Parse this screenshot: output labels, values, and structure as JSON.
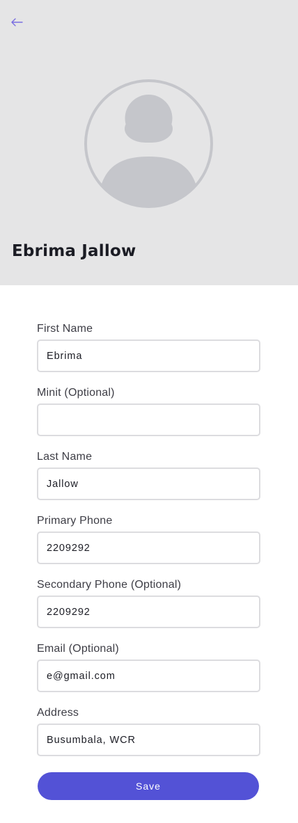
{
  "profile": {
    "name": "Ebrima Jallow"
  },
  "colors": {
    "header_bg": "#e5e5e6",
    "avatar": "#c5c6cb",
    "accent": "#5352d6",
    "back_arrow": "#7a6ee0"
  },
  "icons": {
    "back": "arrow-left-icon",
    "avatar": "person-placeholder-icon"
  },
  "form": {
    "first_name": {
      "label": "First Name",
      "value": "Ebrima"
    },
    "minit": {
      "label": "Minit (Optional)",
      "value": ""
    },
    "last_name": {
      "label": "Last Name",
      "value": "Jallow"
    },
    "primary_phone": {
      "label": "Primary Phone",
      "value": "2209292"
    },
    "secondary_phone": {
      "label": "Secondary Phone (Optional)",
      "value": "2209292"
    },
    "email": {
      "label": "Email (Optional)",
      "value": "e@gmail.com"
    },
    "address": {
      "label": "Address",
      "value": "Busumbala, WCR"
    }
  },
  "actions": {
    "save_label": "Save"
  }
}
